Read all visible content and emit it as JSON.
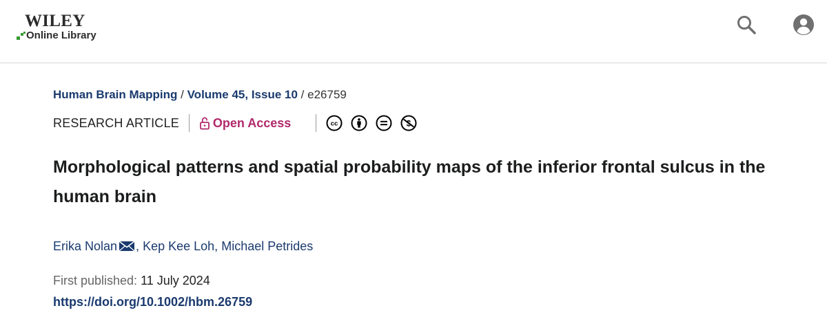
{
  "header": {
    "logo_main": "Wiley",
    "logo_sub": "Online Library",
    "search_icon": "search-icon",
    "user_icon": "account-circle-icon"
  },
  "breadcrumb": {
    "journal": "Human Brain Mapping",
    "separator": "/",
    "volume_issue": "Volume 45, Issue 10",
    "article_id": "e26759"
  },
  "meta": {
    "article_type": "RESEARCH ARTICLE",
    "open_access": "Open Access",
    "license_icons": [
      "cc-icon",
      "attribution-icon",
      "no-derivatives-icon",
      "non-commercial-icon"
    ]
  },
  "article": {
    "title": "Morphological patterns and spatial probability maps of the inferior frontal sulcus in the human brain",
    "authors": [
      "Erika Nolan",
      "Kep Kee Loh",
      "Michael Petrides"
    ],
    "author_separator": ",",
    "first_published_label": "First published:",
    "first_published_date": "11 July 2024",
    "doi": "https://doi.org/10.1002/hbm.26759"
  },
  "colors": {
    "link": "#1a3a6e",
    "open_access": "#b1296b",
    "icon_gray": "#707070",
    "logo_green": "#3a9a34"
  }
}
